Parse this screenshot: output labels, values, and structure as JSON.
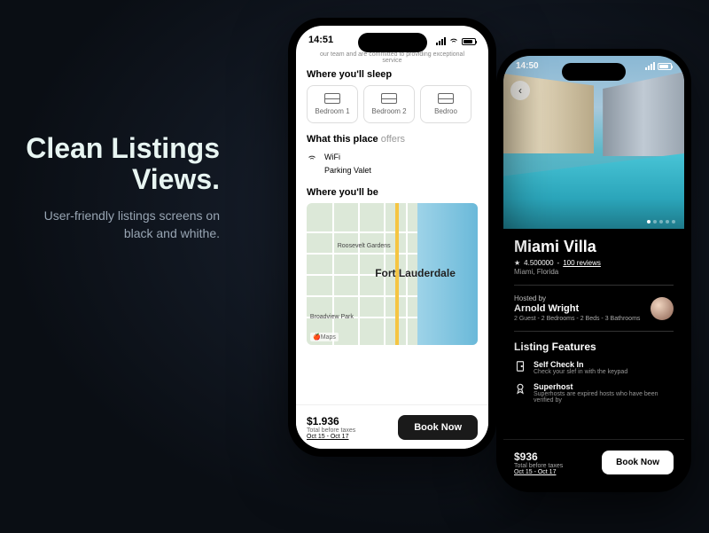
{
  "promo": {
    "title": "Clean Listings Views.",
    "subtitle": "User-friendly listings screens on black and whithe."
  },
  "phone1": {
    "time": "14:51",
    "top_blurb": "our team and are committed to providing exceptional service",
    "sleep": {
      "title": "Where you'll sleep",
      "cards": [
        "Bedroom 1",
        "Bedroom 2",
        "Bedroo"
      ]
    },
    "offers": {
      "title_a": "What this place ",
      "title_b": "offers",
      "items": [
        "WiFi",
        "Parking Valet"
      ]
    },
    "location": {
      "title": "Where you'll be",
      "city": "Fort Lauderdale",
      "label1": "Roosevelt Gardens",
      "label2": "Broadview Park",
      "maps_badge": "Maps"
    },
    "footer": {
      "price": "$1.936",
      "tax": "Total before taxes",
      "dates": "Oct 15 - Oct 17",
      "book": "Book Now"
    }
  },
  "phone2": {
    "time": "14:50",
    "title": "Miami Villa",
    "rating": "4.500000",
    "reviews": "100 reviews",
    "location": "Miami, Florida",
    "host": {
      "label": "Hosted by",
      "name": "Arnold Wright",
      "details": "2 Guest - 2 Bedrooms - 2 Beds - 3 Bathrooms"
    },
    "features": {
      "title": "Listing Features",
      "f1": {
        "name": "Self Check In",
        "desc": "Check your slef in with the keypad"
      },
      "f2": {
        "name": "Superhost",
        "desc": "Superhosts are expired hosts who have been verified by"
      }
    },
    "footer": {
      "price": "$936",
      "tax": "Total before taxes",
      "dates": "Oct 15 - Oct 17",
      "book": "Book Now"
    }
  }
}
